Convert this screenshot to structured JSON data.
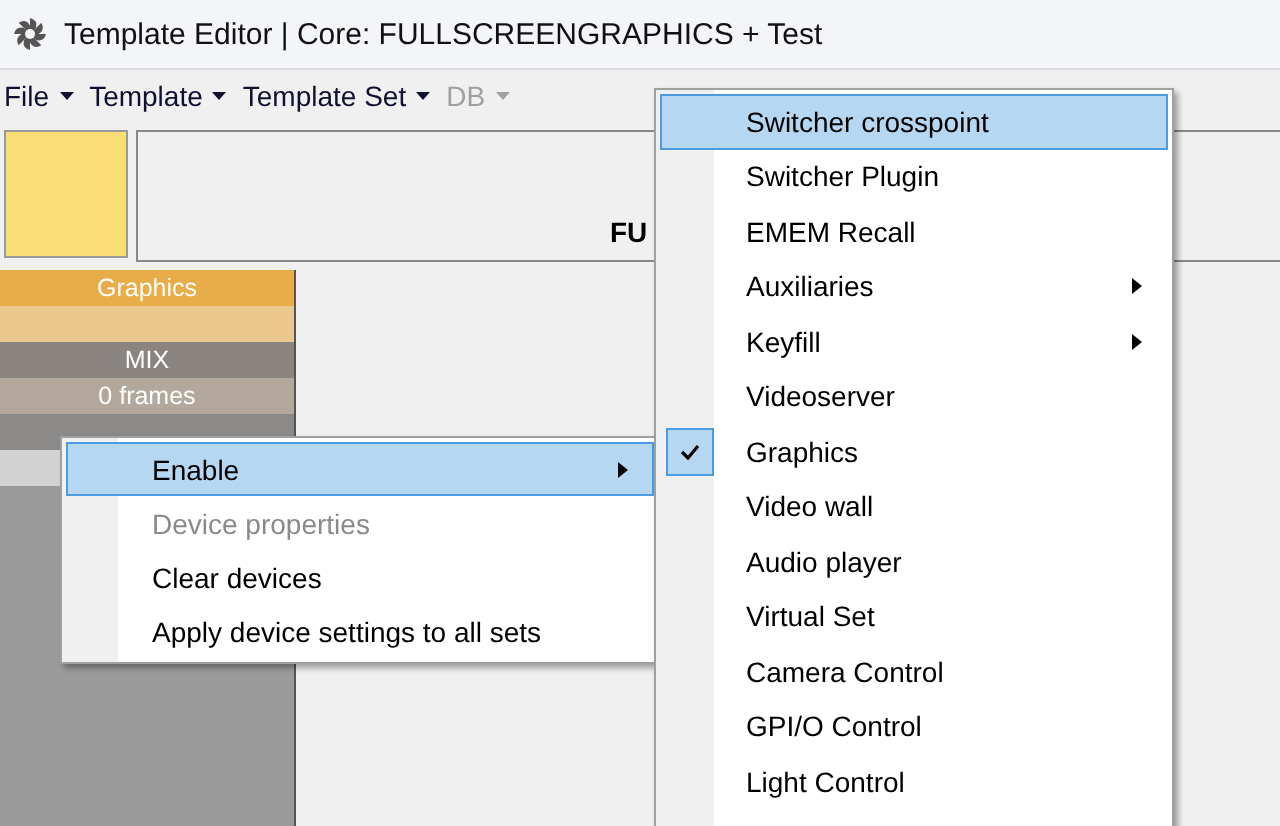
{
  "window": {
    "title": "Template Editor | Core: FULLSCREENGRAPHICS + Test"
  },
  "menu_bar": [
    {
      "label": "File",
      "disabled": false
    },
    {
      "label": "Template",
      "disabled": false
    },
    {
      "label": "Template Set",
      "disabled": false
    },
    {
      "label": "DB",
      "disabled": true
    }
  ],
  "header": {
    "title": "FU"
  },
  "device_column": {
    "rows": [
      {
        "kind": "title",
        "text": "Graphics"
      },
      {
        "kind": "blank"
      },
      {
        "kind": "mode",
        "text": "MIX"
      },
      {
        "kind": "duration",
        "text": "0 frames"
      },
      {
        "kind": "pair"
      },
      {
        "kind": "partial"
      }
    ]
  },
  "context_menu": {
    "items": [
      {
        "label": "Enable",
        "selected": true,
        "disabled": false,
        "has_submenu": true
      },
      {
        "label": "Device properties",
        "selected": false,
        "disabled": true,
        "has_submenu": false
      },
      {
        "label": "Clear devices",
        "selected": false,
        "disabled": false,
        "has_submenu": false
      },
      {
        "label": "Apply device settings to all sets",
        "selected": false,
        "disabled": false,
        "has_submenu": false
      }
    ]
  },
  "submenu": {
    "items": [
      {
        "label": "Switcher crosspoint",
        "selected": true,
        "checked": false,
        "has_submenu": false
      },
      {
        "label": "Switcher Plugin",
        "selected": false,
        "checked": false,
        "has_submenu": false
      },
      {
        "label": "EMEM Recall",
        "selected": false,
        "checked": false,
        "has_submenu": false
      },
      {
        "label": "Auxiliaries",
        "selected": false,
        "checked": false,
        "has_submenu": true
      },
      {
        "label": "Keyfill",
        "selected": false,
        "checked": false,
        "has_submenu": true
      },
      {
        "label": "Videoserver",
        "selected": false,
        "checked": false,
        "has_submenu": false
      },
      {
        "label": "Graphics",
        "selected": false,
        "checked": true,
        "has_submenu": false
      },
      {
        "label": "Video wall",
        "selected": false,
        "checked": false,
        "has_submenu": false
      },
      {
        "label": "Audio player",
        "selected": false,
        "checked": false,
        "has_submenu": false
      },
      {
        "label": "Virtual Set",
        "selected": false,
        "checked": false,
        "has_submenu": false
      },
      {
        "label": "Camera Control",
        "selected": false,
        "checked": false,
        "has_submenu": false
      },
      {
        "label": "GPI/O Control",
        "selected": false,
        "checked": false,
        "has_submenu": false
      },
      {
        "label": "Light Control",
        "selected": false,
        "checked": false,
        "has_submenu": false
      }
    ]
  }
}
